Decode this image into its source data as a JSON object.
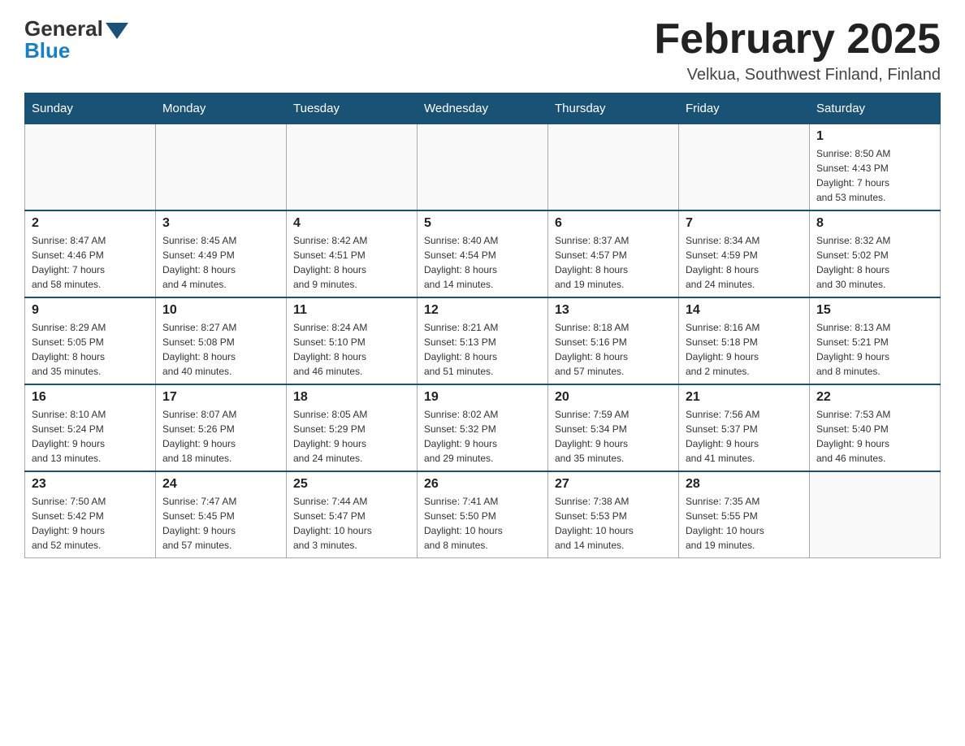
{
  "header": {
    "logo_general": "General",
    "logo_blue": "Blue",
    "month_title": "February 2025",
    "location": "Velkua, Southwest Finland, Finland"
  },
  "days_of_week": [
    "Sunday",
    "Monday",
    "Tuesday",
    "Wednesday",
    "Thursday",
    "Friday",
    "Saturday"
  ],
  "weeks": [
    [
      {
        "day": "",
        "info": ""
      },
      {
        "day": "",
        "info": ""
      },
      {
        "day": "",
        "info": ""
      },
      {
        "day": "",
        "info": ""
      },
      {
        "day": "",
        "info": ""
      },
      {
        "day": "",
        "info": ""
      },
      {
        "day": "1",
        "info": "Sunrise: 8:50 AM\nSunset: 4:43 PM\nDaylight: 7 hours\nand 53 minutes."
      }
    ],
    [
      {
        "day": "2",
        "info": "Sunrise: 8:47 AM\nSunset: 4:46 PM\nDaylight: 7 hours\nand 58 minutes."
      },
      {
        "day": "3",
        "info": "Sunrise: 8:45 AM\nSunset: 4:49 PM\nDaylight: 8 hours\nand 4 minutes."
      },
      {
        "day": "4",
        "info": "Sunrise: 8:42 AM\nSunset: 4:51 PM\nDaylight: 8 hours\nand 9 minutes."
      },
      {
        "day": "5",
        "info": "Sunrise: 8:40 AM\nSunset: 4:54 PM\nDaylight: 8 hours\nand 14 minutes."
      },
      {
        "day": "6",
        "info": "Sunrise: 8:37 AM\nSunset: 4:57 PM\nDaylight: 8 hours\nand 19 minutes."
      },
      {
        "day": "7",
        "info": "Sunrise: 8:34 AM\nSunset: 4:59 PM\nDaylight: 8 hours\nand 24 minutes."
      },
      {
        "day": "8",
        "info": "Sunrise: 8:32 AM\nSunset: 5:02 PM\nDaylight: 8 hours\nand 30 minutes."
      }
    ],
    [
      {
        "day": "9",
        "info": "Sunrise: 8:29 AM\nSunset: 5:05 PM\nDaylight: 8 hours\nand 35 minutes."
      },
      {
        "day": "10",
        "info": "Sunrise: 8:27 AM\nSunset: 5:08 PM\nDaylight: 8 hours\nand 40 minutes."
      },
      {
        "day": "11",
        "info": "Sunrise: 8:24 AM\nSunset: 5:10 PM\nDaylight: 8 hours\nand 46 minutes."
      },
      {
        "day": "12",
        "info": "Sunrise: 8:21 AM\nSunset: 5:13 PM\nDaylight: 8 hours\nand 51 minutes."
      },
      {
        "day": "13",
        "info": "Sunrise: 8:18 AM\nSunset: 5:16 PM\nDaylight: 8 hours\nand 57 minutes."
      },
      {
        "day": "14",
        "info": "Sunrise: 8:16 AM\nSunset: 5:18 PM\nDaylight: 9 hours\nand 2 minutes."
      },
      {
        "day": "15",
        "info": "Sunrise: 8:13 AM\nSunset: 5:21 PM\nDaylight: 9 hours\nand 8 minutes."
      }
    ],
    [
      {
        "day": "16",
        "info": "Sunrise: 8:10 AM\nSunset: 5:24 PM\nDaylight: 9 hours\nand 13 minutes."
      },
      {
        "day": "17",
        "info": "Sunrise: 8:07 AM\nSunset: 5:26 PM\nDaylight: 9 hours\nand 18 minutes."
      },
      {
        "day": "18",
        "info": "Sunrise: 8:05 AM\nSunset: 5:29 PM\nDaylight: 9 hours\nand 24 minutes."
      },
      {
        "day": "19",
        "info": "Sunrise: 8:02 AM\nSunset: 5:32 PM\nDaylight: 9 hours\nand 29 minutes."
      },
      {
        "day": "20",
        "info": "Sunrise: 7:59 AM\nSunset: 5:34 PM\nDaylight: 9 hours\nand 35 minutes."
      },
      {
        "day": "21",
        "info": "Sunrise: 7:56 AM\nSunset: 5:37 PM\nDaylight: 9 hours\nand 41 minutes."
      },
      {
        "day": "22",
        "info": "Sunrise: 7:53 AM\nSunset: 5:40 PM\nDaylight: 9 hours\nand 46 minutes."
      }
    ],
    [
      {
        "day": "23",
        "info": "Sunrise: 7:50 AM\nSunset: 5:42 PM\nDaylight: 9 hours\nand 52 minutes."
      },
      {
        "day": "24",
        "info": "Sunrise: 7:47 AM\nSunset: 5:45 PM\nDaylight: 9 hours\nand 57 minutes."
      },
      {
        "day": "25",
        "info": "Sunrise: 7:44 AM\nSunset: 5:47 PM\nDaylight: 10 hours\nand 3 minutes."
      },
      {
        "day": "26",
        "info": "Sunrise: 7:41 AM\nSunset: 5:50 PM\nDaylight: 10 hours\nand 8 minutes."
      },
      {
        "day": "27",
        "info": "Sunrise: 7:38 AM\nSunset: 5:53 PM\nDaylight: 10 hours\nand 14 minutes."
      },
      {
        "day": "28",
        "info": "Sunrise: 7:35 AM\nSunset: 5:55 PM\nDaylight: 10 hours\nand 19 minutes."
      },
      {
        "day": "",
        "info": ""
      }
    ]
  ]
}
